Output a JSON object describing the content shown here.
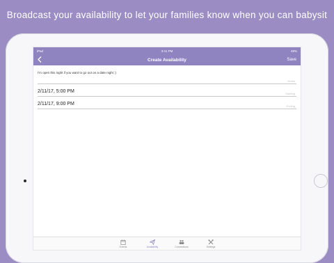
{
  "banner": {
    "text": "Broadcast your availability to let your families know when you can babysit"
  },
  "status_bar": {
    "carrier": "iPad",
    "time": "3:41 PM",
    "battery": "49%"
  },
  "nav": {
    "back_icon": "chevron-left-icon",
    "title": "Create Availability",
    "save_label": "Save"
  },
  "form": {
    "notes_text": "I'm open this night if you want to go out on a date night :)",
    "notes_hint": "Notes",
    "starting_value": "2/11/17, 5:00 PM",
    "starting_hint": "Starting",
    "ending_value": "2/11/17, 9:00 PM",
    "ending_hint": "Ending"
  },
  "tabs": [
    {
      "label": "Events",
      "icon": "calendar-icon",
      "active": false
    },
    {
      "label": "Availability",
      "icon": "paper-plane-icon",
      "active": true
    },
    {
      "label": "Connections",
      "icon": "people-icon",
      "active": false
    },
    {
      "label": "Settings",
      "icon": "tools-icon",
      "active": false
    }
  ],
  "colors": {
    "background": "#9b8dc4",
    "navbar": "#8f84bf",
    "accent": "#8f84bf"
  }
}
